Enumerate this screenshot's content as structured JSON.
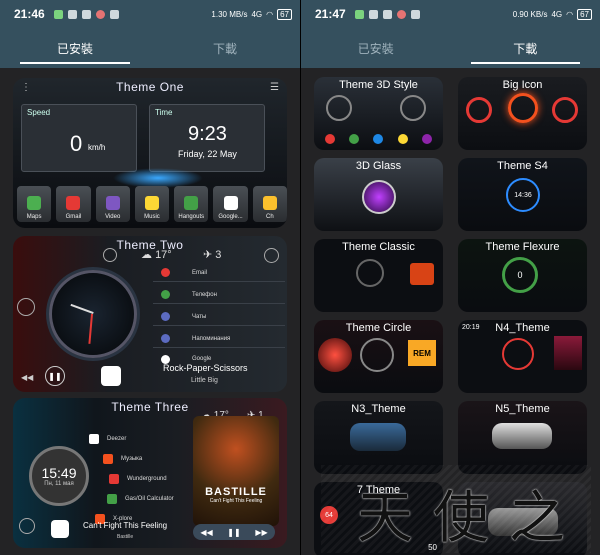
{
  "left": {
    "status": {
      "time": "21:46",
      "net": "1.30 MB/s",
      "signal": "4G",
      "battery": "67"
    },
    "tabs": [
      {
        "label": "已安裝"
      },
      {
        "label": "下載"
      }
    ],
    "cards": {
      "one": {
        "title": "Theme  One",
        "speed_label": "Speed",
        "speed_value": "0",
        "speed_unit": "km/h",
        "time_label": "Time",
        "time_value": "9:23",
        "date_value": "Friday, 22 May",
        "apps": [
          "Maps",
          "Gmail",
          "Video",
          "Music",
          "Hangouts",
          "Google...",
          "Ch"
        ]
      },
      "two": {
        "title": "Theme  Two",
        "temp": "17°",
        "count": "3",
        "menu": [
          "Email",
          "Телефон",
          "Чаты",
          "Напоминания",
          "Google"
        ],
        "track": "Rock-Paper-Scissors",
        "artist": "Little Big"
      },
      "three": {
        "title": "Theme  Three",
        "temp": "17°",
        "count": "1",
        "clock": "15:49",
        "date": "Пн, 11 мая",
        "apps": [
          "Deezer",
          "Музыка",
          "Wunderground",
          "Gas/Oil Calculator",
          "X-plore"
        ],
        "album_title": "BASTILLE",
        "album_sub": "Can't Fight This Feeling",
        "track": "Can't Fight This Feeling",
        "artist": "Bastille"
      }
    }
  },
  "right": {
    "status": {
      "time": "21:47",
      "net": "0.90 KB/s",
      "signal": "4G",
      "battery": "67"
    },
    "tabs": [
      {
        "label": "已安裝"
      },
      {
        "label": "下載"
      }
    ],
    "tiles": [
      {
        "title": "Theme 3D Style"
      },
      {
        "title": "Big Icon"
      },
      {
        "title": "3D Glass"
      },
      {
        "title": "Theme S4"
      },
      {
        "title": "Theme Classic"
      },
      {
        "title": "Theme Flexure"
      },
      {
        "title": "Theme Circle"
      },
      {
        "title": "N4_Theme"
      },
      {
        "title": "N3_Theme"
      },
      {
        "title": "N5_Theme"
      },
      {
        "title": "7 Theme"
      },
      {
        "title": ""
      }
    ],
    "tile_readouts": {
      "s4_clock": "14:36",
      "flexure_speed": "0",
      "circle_label": "REM",
      "n4_time": "20:19",
      "n7_speed": "64",
      "n7_val": "50"
    }
  },
  "colors": {
    "header": "#35505e",
    "accent_red": "#e53935",
    "accent_blue": "#2d8cff"
  }
}
